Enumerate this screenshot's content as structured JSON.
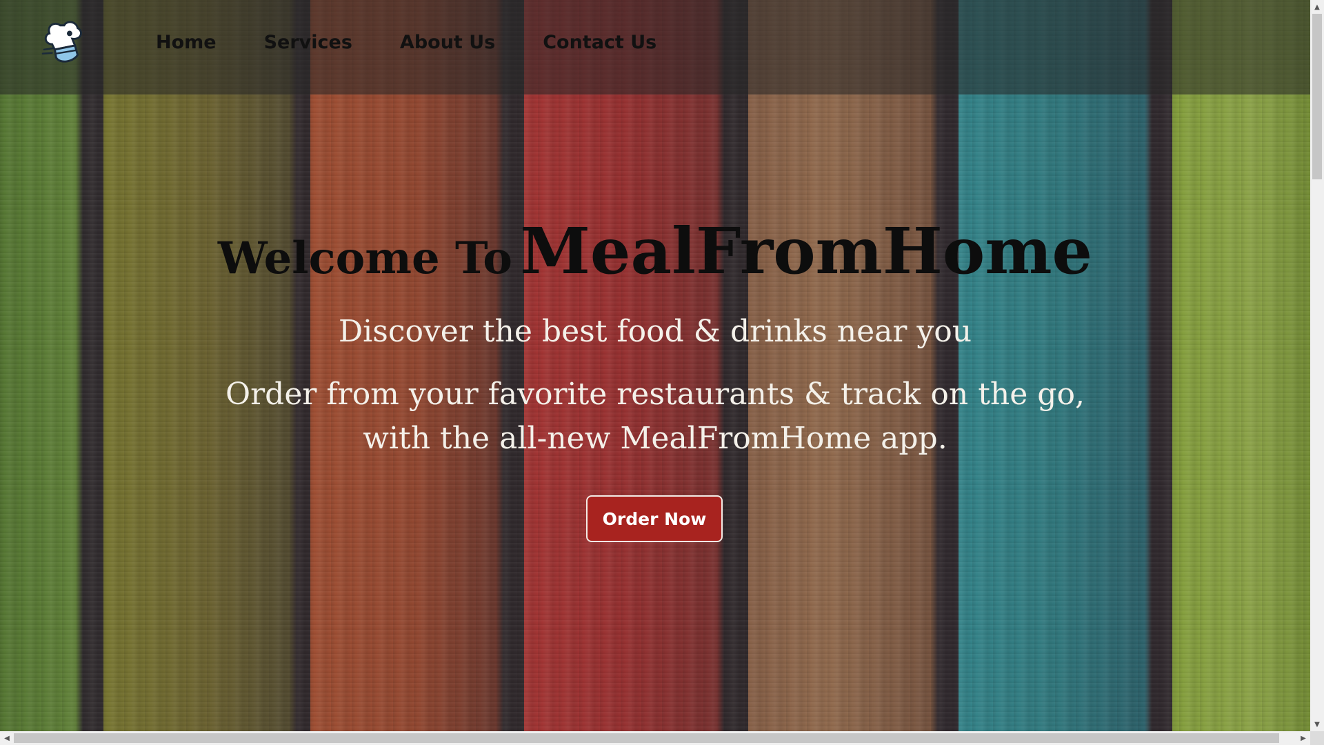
{
  "brand": {
    "logo_icon": "chef-hat-icon"
  },
  "nav": {
    "home": "Home",
    "services": "Services",
    "about": "About Us",
    "contact": "Contact Us"
  },
  "hero": {
    "title_prefix": "Welcome To",
    "title_brand": "MealFromHome",
    "tagline": "Discover the best food & drinks near you",
    "description": "Order from your favorite restaurants & track on the go, with the all-new MealFromHome app.",
    "cta_label": "Order Now"
  },
  "colors": {
    "nav_overlay": "#282828",
    "cta_background": "#a8231f",
    "title_text": "#0d0d0d",
    "body_text": "#f4f1ea"
  },
  "scrollbars": {
    "up": "▲",
    "down": "▼",
    "left": "◀",
    "right": "▶"
  }
}
